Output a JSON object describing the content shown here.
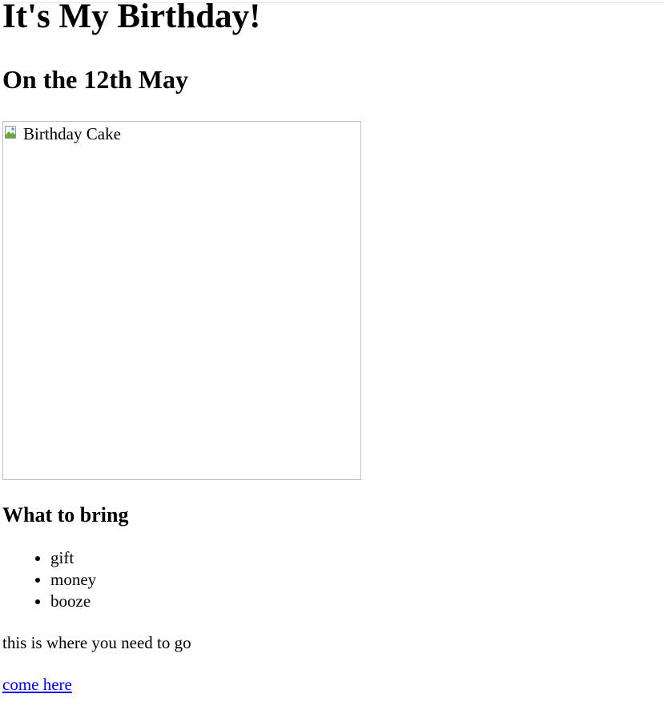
{
  "page": {
    "title": "It's My Birthday!",
    "subtitle": "On the 12th May",
    "image_alt": "Birthday Cake",
    "bring_heading": "What to bring",
    "bring_items": [
      "gift",
      "money",
      "booze"
    ],
    "directions_text": "this is where you need to go",
    "link_text": "come here"
  },
  "colors": {
    "link": "#0000ee",
    "image_border": "#c0c0c0"
  }
}
